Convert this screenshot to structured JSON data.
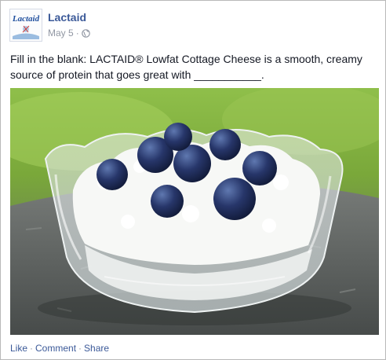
{
  "post": {
    "page_name": "Lactaid",
    "logo_text": "Lactaid",
    "date": "May 5",
    "meta_separator": "·",
    "privacy_icon": "globe-icon",
    "message": "Fill in the blank: LACTAID® Lowfat Cottage Cheese is a smooth, creamy source of protein that goes great with ___________.",
    "photo_subject": "glass bowl of cottage cheese topped with blueberries"
  },
  "actions": {
    "like": "Like",
    "comment": "Comment",
    "share": "Share",
    "separator": "·"
  },
  "colors": {
    "link": "#3b5998",
    "meta": "#9197a3",
    "text": "#141823",
    "border": "#b9b9b9"
  }
}
